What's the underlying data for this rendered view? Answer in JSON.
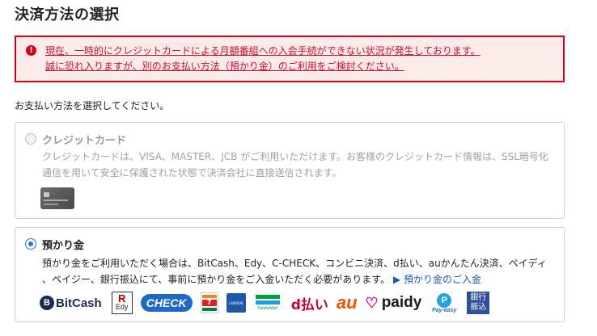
{
  "page_title": "決済方法の選択",
  "alert": {
    "icon": "exclamation-icon",
    "line1": "現在、一時的にクレジットカードによる月額番組への入会手続ができない状況が発生しております。",
    "line2": "誠に恐れ入りますが、別のお支払い方法（預かり金）のご利用をご検討ください。"
  },
  "instruction": "お支払い方法を選択してください。",
  "payment_methods": [
    {
      "label": "クレジットカード",
      "selected": false,
      "disabled": true,
      "desc_line1": "クレジットカードは、VISA、MASTER、JCB がご利用いただけます。お客様のクレジットカード情報は、SSL暗号化",
      "desc_line2": "通信を用いて安全に保護された状態で決済会社に直接送信されます。"
    },
    {
      "label": "預かり金",
      "selected": true,
      "disabled": false,
      "desc_line1": "預かり金をご利用いただく場合は、BitCash、Edy、C-CHECK、コンビニ決済、d払い、auかんたん決済、ペイディ",
      "desc_line2": "、ペイジー、銀行振込にて、事前に預かり金をご入金いただく必要があります。",
      "link_arrow": "▶",
      "link_text": "預かり金のご入金"
    }
  ],
  "logos": {
    "bitcash": "BitCash",
    "edy_r": "R",
    "edy": "Edy",
    "check": "CHECK",
    "seven_eleven": "7",
    "lawson": "LAWSON",
    "familymart": "FamilyMart",
    "d_barai": "d払い",
    "au": "au",
    "paidy": "paidy",
    "payeasy": "Pay-easy",
    "bank_line1": "銀行",
    "bank_line2": "振込"
  },
  "colors": {
    "alert_border": "#d0021b",
    "alert_text": "#c8102e",
    "alert_bg": "#fbeaea",
    "radio_selected": "#2d6fd6",
    "link": "#1a5cb0"
  }
}
